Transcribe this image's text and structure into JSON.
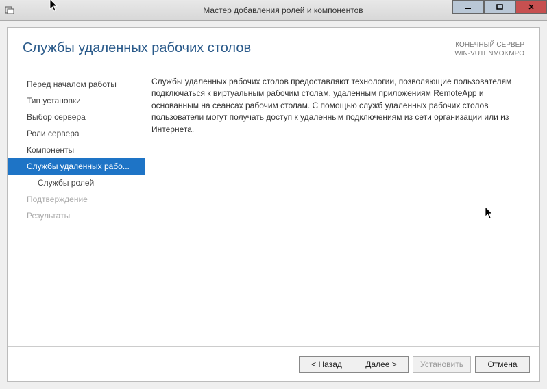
{
  "titlebar": {
    "title": "Мастер добавления ролей и компонентов"
  },
  "header": {
    "page_title": "Службы удаленных рабочих столов",
    "server_label": "КОНЕЧНЫЙ СЕРВЕР",
    "server_name": "WIN-VU1ENMOKMPO"
  },
  "nav": {
    "items": [
      {
        "label": "Перед началом работы"
      },
      {
        "label": "Тип установки"
      },
      {
        "label": "Выбор сервера"
      },
      {
        "label": "Роли сервера"
      },
      {
        "label": "Компоненты"
      },
      {
        "label": "Службы удаленных рабо..."
      },
      {
        "label": "Службы ролей"
      },
      {
        "label": "Подтверждение"
      },
      {
        "label": "Результаты"
      }
    ]
  },
  "description": "Службы удаленных рабочих столов предоставляют технологии, позволяющие пользователям подключаться к виртуальным рабочим столам, удаленным приложениям RemoteApp и основанным на сеансах рабочим столам. С помощью служб удаленных рабочих столов пользователи могут получать доступ к удаленным подключениям из сети организации или из Интернета.",
  "footer": {
    "back": "< Назад",
    "next": "Далее >",
    "install": "Установить",
    "cancel": "Отмена"
  }
}
